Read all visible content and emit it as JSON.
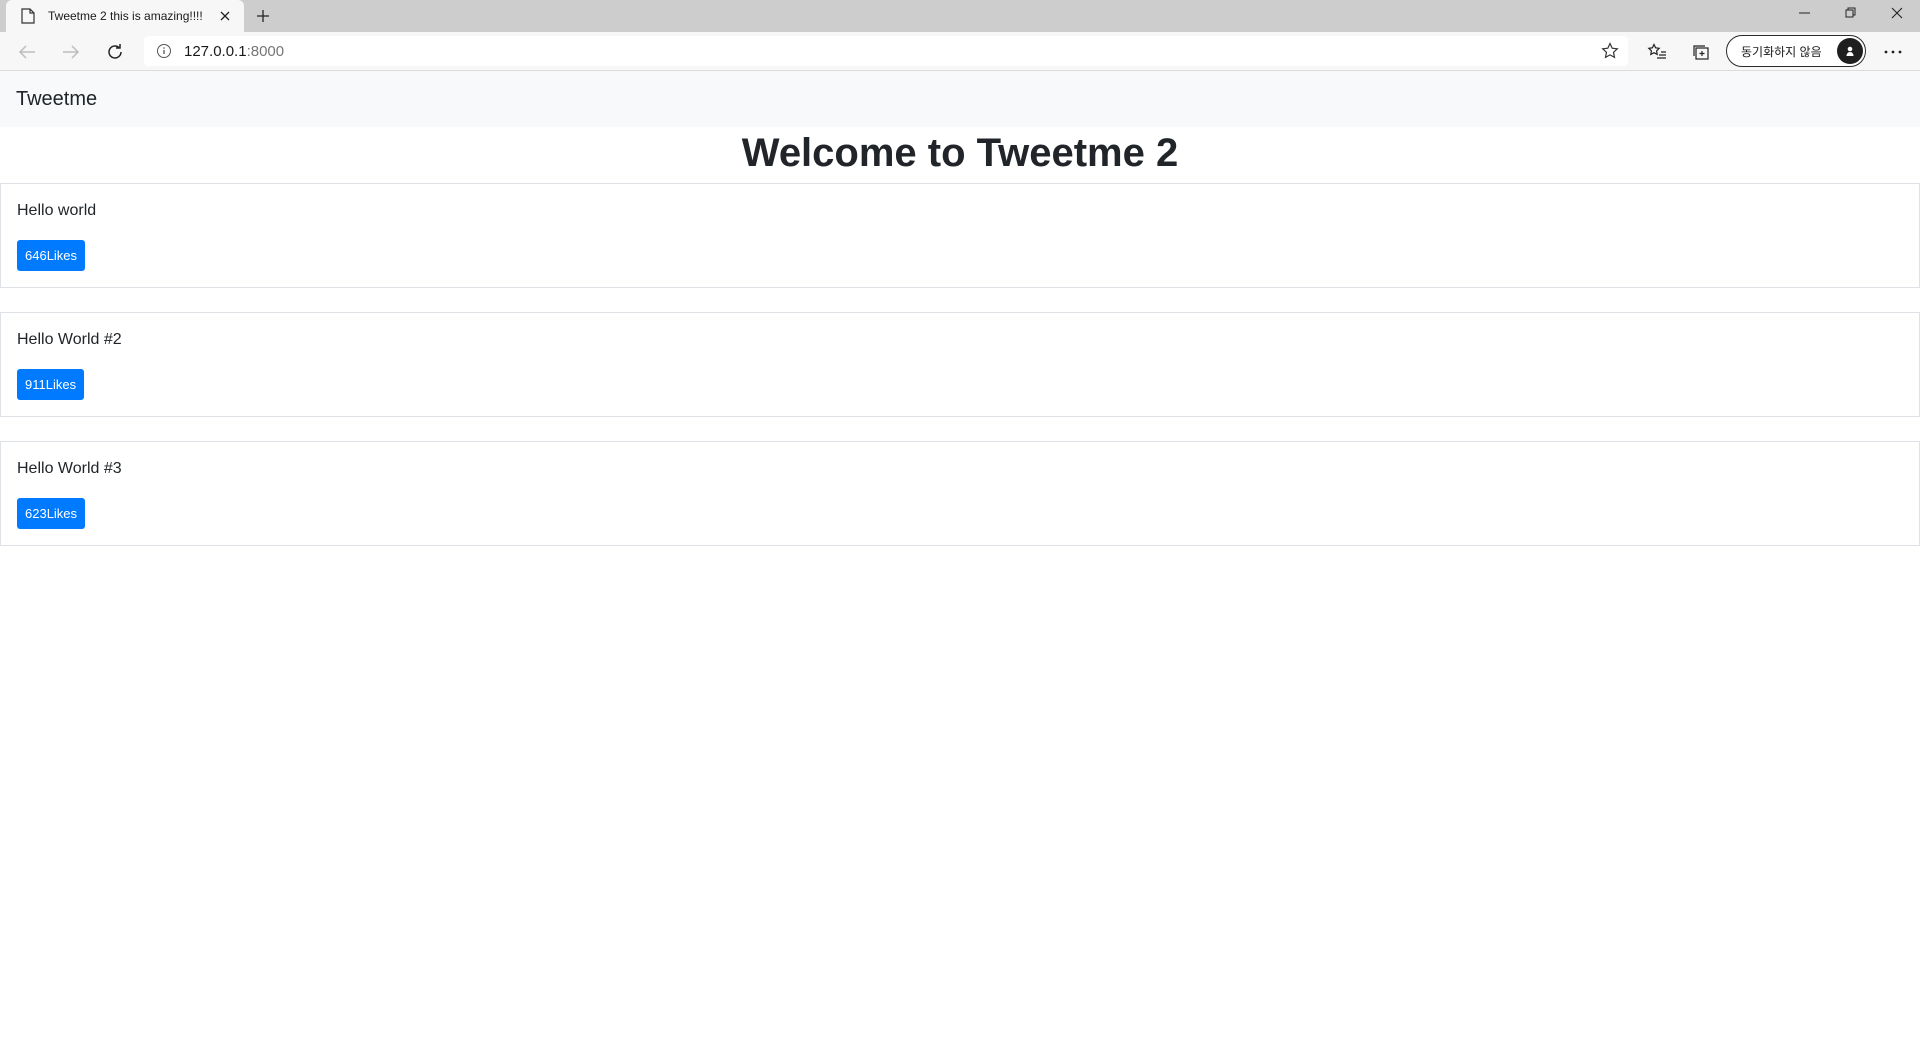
{
  "browser": {
    "tab_title": "Tweetme 2 this is amazing!!!!",
    "url_host": "127.0.0.1",
    "url_port": ":8000",
    "sync_label": "동기화하지 않음"
  },
  "page": {
    "brand": "Tweetme",
    "heading": "Welcome to Tweetme 2",
    "tweets": [
      {
        "content": "Hello world",
        "likes_label": "646Likes"
      },
      {
        "content": "Hello World #2",
        "likes_label": "911Likes"
      },
      {
        "content": "Hello World #3",
        "likes_label": "623Likes"
      }
    ]
  },
  "colors": {
    "like_button": "#007bff",
    "navbar_bg": "#f8f9fa"
  }
}
